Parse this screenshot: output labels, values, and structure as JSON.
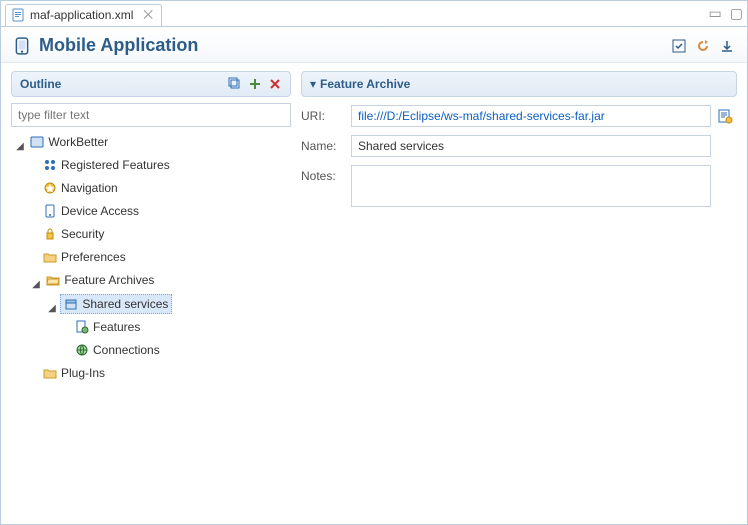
{
  "tab": {
    "label": "maf-application.xml",
    "icon": "xml-file-icon"
  },
  "editor": {
    "title": "Mobile Application"
  },
  "outline": {
    "title": "Outline",
    "filter_placeholder": "type filter text",
    "tree": {
      "root": "WorkBetter",
      "children": {
        "registered_features": "Registered Features",
        "navigation": "Navigation",
        "device_access": "Device Access",
        "security": "Security",
        "preferences": "Preferences",
        "feature_archives": {
          "label": "Feature Archives",
          "children": {
            "shared_services": {
              "label": "Shared services",
              "children": {
                "features": "Features",
                "connections": "Connections"
              }
            }
          }
        },
        "plugins": "Plug-Ins"
      }
    }
  },
  "form": {
    "section_title": "Feature Archive",
    "labels": {
      "uri": "URI:",
      "name": "Name:",
      "notes": "Notes:"
    },
    "values": {
      "uri": "file:///D:/Eclipse/ws-maf/shared-services-far.jar",
      "name": "Shared services",
      "notes": ""
    }
  }
}
